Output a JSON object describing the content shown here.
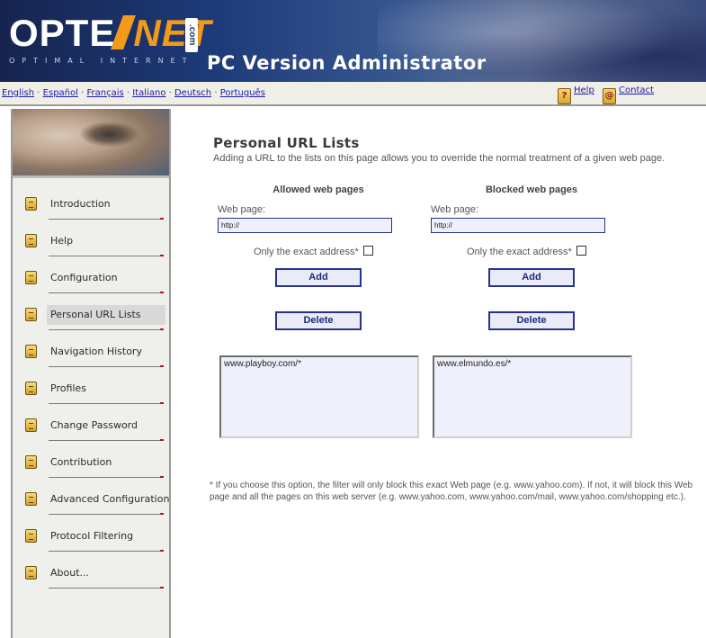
{
  "header": {
    "logo_opte": "OPTE",
    "logo_net": "NET",
    "logo_com": ".com",
    "logo_tagline": "OPTIMAL INTERNET",
    "title": "PC Version Administrator"
  },
  "languages": {
    "items": [
      "English",
      "Español",
      "Français",
      "Italiano",
      "Deutsch",
      "Português"
    ],
    "separator": "·"
  },
  "helpbar": {
    "help_label": "Help",
    "contact_label": "Contact"
  },
  "sidebar": {
    "items": [
      {
        "label": "Introduction"
      },
      {
        "label": "Help"
      },
      {
        "label": "Configuration"
      },
      {
        "label": "Personal URL Lists"
      },
      {
        "label": "Navigation History"
      },
      {
        "label": "Profiles"
      },
      {
        "label": "Change Password"
      },
      {
        "label": "Contribution"
      },
      {
        "label": "Advanced Configuration"
      },
      {
        "label": "Protocol Filtering"
      },
      {
        "label": "About..."
      }
    ],
    "active_index": 3
  },
  "main": {
    "title": "Personal URL Lists",
    "subtitle": "Adding a URL to the lists on this page allows you to override the normal treatment of a given web page.",
    "allowed": {
      "heading": "Allowed web pages",
      "web_page_label": "Web page:",
      "url_value": "http://",
      "exact_label": "Only the exact address*",
      "exact_checked": false,
      "add_label": "Add",
      "delete_label": "Delete",
      "entries": [
        "www.playboy.com/*"
      ]
    },
    "blocked": {
      "heading": "Blocked web pages",
      "web_page_label": "Web page:",
      "url_value": "http://",
      "exact_label": "Only the exact address*",
      "exact_checked": false,
      "add_label": "Add",
      "delete_label": "Delete",
      "entries": [
        "www.elmundo.es/*"
      ]
    },
    "footnote": "* If you choose this option, the filter will only block this exact Web page (e.g. www.yahoo.com). If not, it will block this Web page and all the pages on this web server (e.g. www.yahoo.com, www.yahoo.com/mail, www.yahoo.com/shopping etc.)."
  }
}
